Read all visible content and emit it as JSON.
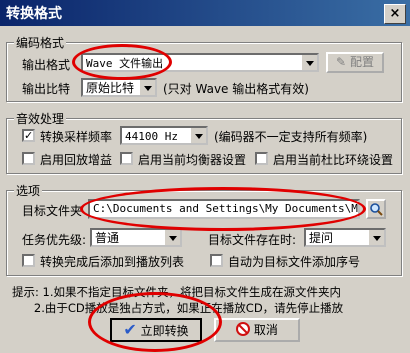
{
  "window": {
    "title": "转换格式",
    "close": "×"
  },
  "encode": {
    "group_label": "编码格式",
    "format_label": "输出格式",
    "format_value": "Wave 文件输出",
    "config_button": "配置",
    "bitrate_label": "输出比特",
    "bitrate_value": "原始比特",
    "bitrate_note": "(只对 Wave 输出格式有效)"
  },
  "audio": {
    "group_label": "音效处理",
    "resample_label": "转换采样频率",
    "resample_checked": true,
    "rate_value": "44100 Hz",
    "rate_note": "(编码器不一定支持所有频率)",
    "replaygain_label": "启用回放增益",
    "equalizer_label": "启用当前均衡器设置",
    "dolby_label": "启用当前杜比环绕设置"
  },
  "options": {
    "group_label": "选项",
    "target_label": "目标文件夹",
    "target_value": "C:\\Documents and Settings\\My Documents\\My Mu",
    "priority_label": "任务优先级:",
    "priority_value": "普通",
    "exists_label": "目标文件存在时:",
    "exists_value": "提问",
    "add_playlist_label": "转换完成后添加到播放列表",
    "auto_number_label": "自动为目标文件添加序号"
  },
  "hints": {
    "line1": "提示: 1.如果不指定目标文件夹，将把目标文件生成在源文件夹内",
    "line2": "      2.由于CD播放是独占方式，如果正在播放CD，请先停止播放"
  },
  "footer": {
    "convert_button": "立即转换",
    "cancel_button": "取消"
  }
}
